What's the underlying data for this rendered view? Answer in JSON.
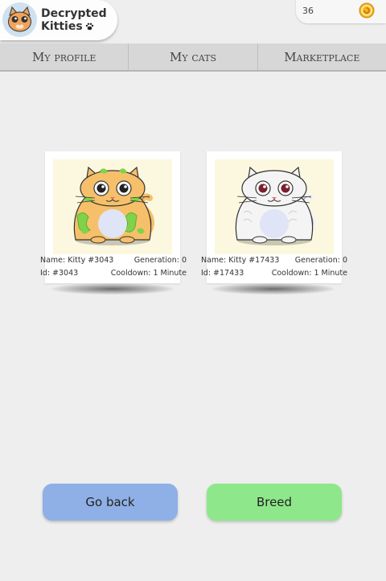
{
  "header": {
    "logo_line1": "Decrypted",
    "logo_line2": "Kitties",
    "balance": "36"
  },
  "tabs": [
    {
      "label": "My profile"
    },
    {
      "label": "My cats"
    },
    {
      "label": "Marketplace"
    }
  ],
  "cats": [
    {
      "name": "Name: Kitty #3043",
      "generation": "Generation: 0",
      "id": "Id: #3043",
      "cooldown": "Cooldown: 1 Minute",
      "body_color": "#f6c06a",
      "pattern_color": "#7fd34a"
    },
    {
      "name": "Name: Kitty #17433",
      "generation": "Generation: 0",
      "id": "Id: #17433",
      "cooldown": "Cooldown: 1 Minute",
      "body_color": "#f4f4f4",
      "pattern_color": "#ffffff"
    }
  ],
  "actions": {
    "back_label": "Go back",
    "breed_label": "Breed"
  },
  "colors": {
    "back_button": "#8fb0e6",
    "breed_button": "#8ee78a"
  }
}
